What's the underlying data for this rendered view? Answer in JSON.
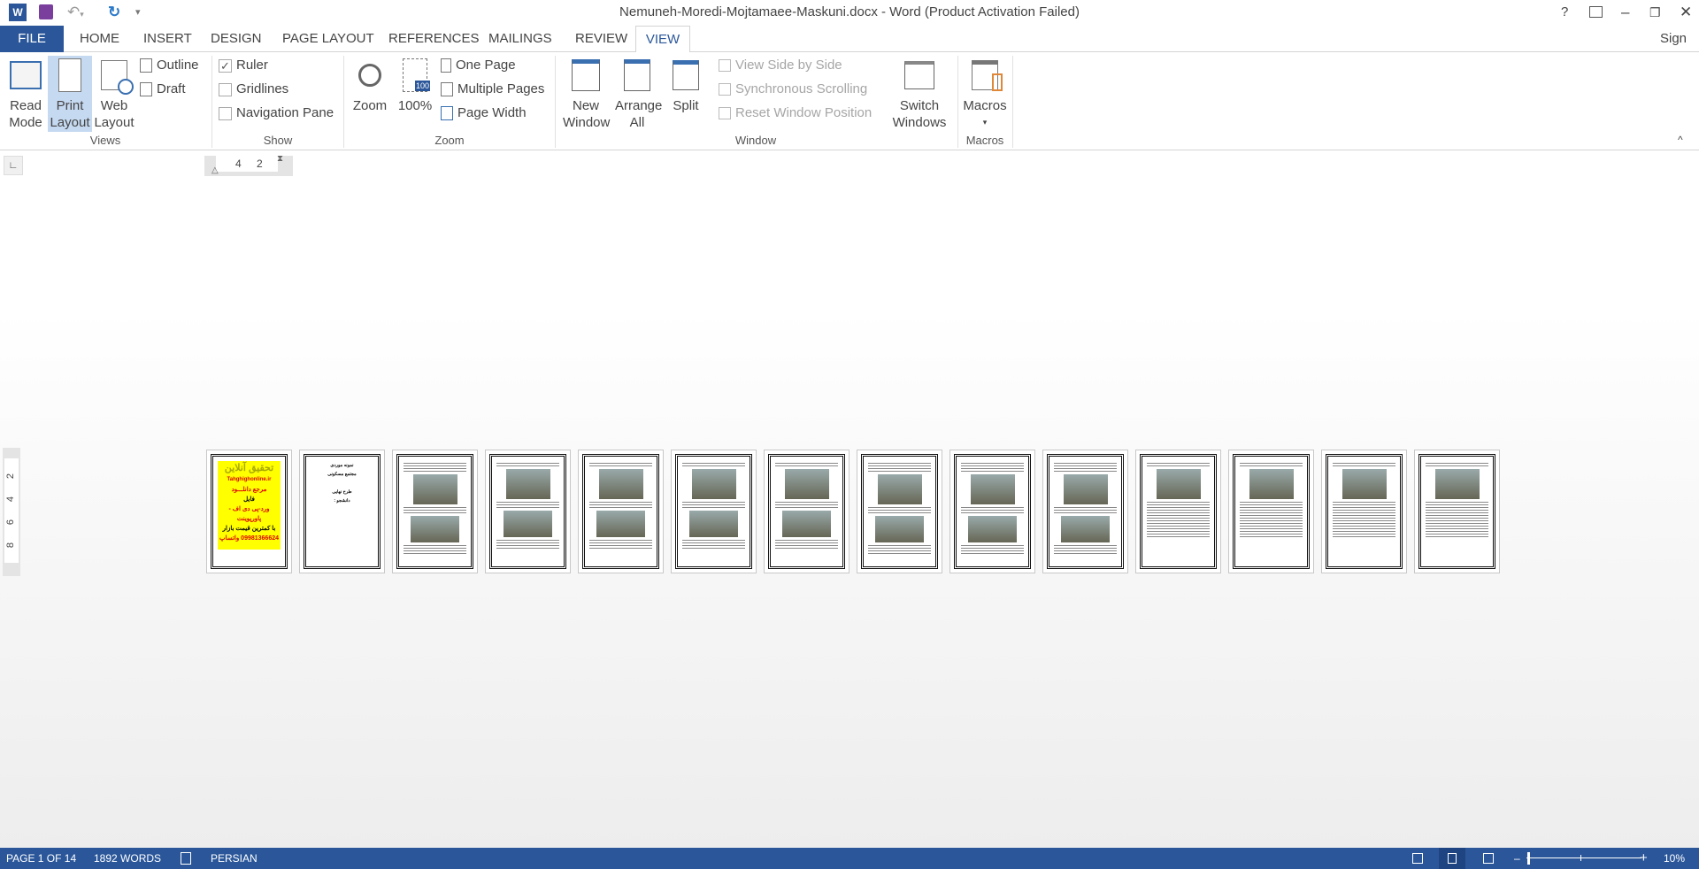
{
  "window": {
    "title": "Nemuneh-Moredi-Mojtamaee-Maskuni.docx - Word (Product Activation Failed)",
    "help": "?",
    "sign_in": "Sign in"
  },
  "tabs": [
    {
      "label": "FILE"
    },
    {
      "label": "HOME"
    },
    {
      "label": "INSERT"
    },
    {
      "label": "DESIGN"
    },
    {
      "label": "PAGE LAYOUT"
    },
    {
      "label": "REFERENCES"
    },
    {
      "label": "MAILINGS"
    },
    {
      "label": "REVIEW"
    },
    {
      "label": "VIEW",
      "active": true
    }
  ],
  "ribbon": {
    "views": {
      "label": "Views",
      "read_mode": "Read Mode",
      "print_layout": "Print Layout",
      "web_layout": "Web Layout",
      "outline": "Outline",
      "draft": "Draft"
    },
    "show": {
      "label": "Show",
      "ruler": "Ruler",
      "ruler_checked": true,
      "gridlines": "Gridlines",
      "gridlines_checked": false,
      "navigation_pane": "Navigation Pane",
      "navigation_pane_checked": false
    },
    "zoom": {
      "label": "Zoom",
      "zoom": "Zoom",
      "hundred": "100%",
      "badge": "100",
      "one_page": "One Page",
      "multiple_pages": "Multiple Pages",
      "page_width": "Page Width"
    },
    "window": {
      "label": "Window",
      "new_window": "New Window",
      "arrange_all": "Arrange All",
      "split": "Split",
      "side_by_side": "View Side by Side",
      "sync_scroll": "Synchronous Scrolling",
      "reset_position": "Reset Window Position",
      "switch_windows": "Switch Windows"
    },
    "macros": {
      "label": "Macros",
      "macros": "Macros"
    }
  },
  "ruler": {
    "h_ticks": [
      "4",
      "2"
    ],
    "v_ticks": [
      "2",
      "4",
      "6",
      "8"
    ]
  },
  "pages": {
    "count": 14,
    "cover": {
      "title": "تحقیق آنلاین",
      "site": "Tahghighonline.ir",
      "line1": "مرجع دانلـــود",
      "line2": "فایل",
      "line3": "ورد-پی دی اف - پاورپوینت",
      "line4": "با کمترین قیمت بازار",
      "line5": "09981366624 واتساپ"
    },
    "title_page": {
      "l1": "نمونه موردی",
      "l2": "مجتمع مسکونی",
      "l3": "طرح نهایی",
      "l4": "دانشجو :"
    }
  },
  "status": {
    "page": "PAGE 1 OF 14",
    "words": "1892 WORDS",
    "language": "PERSIAN",
    "zoom": "10%",
    "zoom_level_percent": 10
  },
  "colors": {
    "accent": "#2b579a",
    "cover_bg": "#ffff00"
  }
}
